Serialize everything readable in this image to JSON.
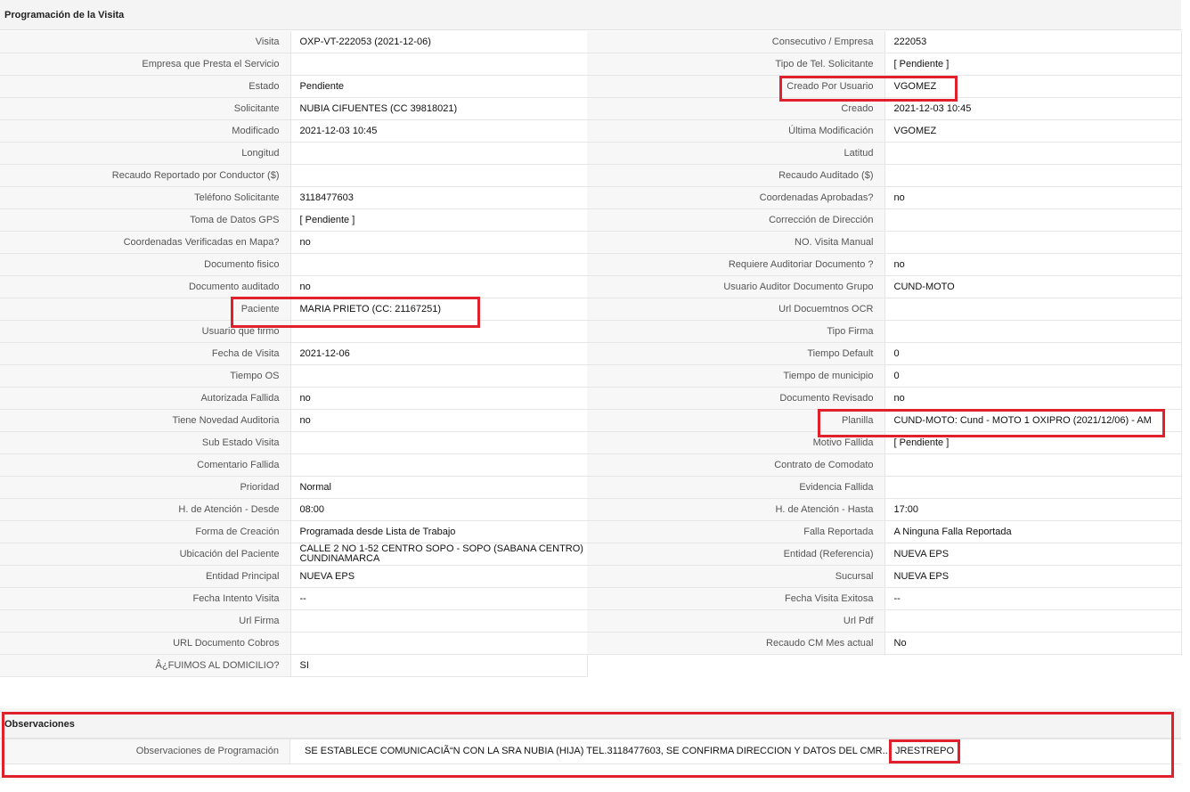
{
  "section1": {
    "title": "Programación de la Visita"
  },
  "left_rows": [
    {
      "label": "Visita",
      "value": "OXP-VT-222053 (2021-12-06)"
    },
    {
      "label": "Empresa que Presta el Servicio",
      "value": ""
    },
    {
      "label": "Estado",
      "value": "Pendiente"
    },
    {
      "label": "Solicitante",
      "value": "NUBIA CIFUENTES (CC 39818021)"
    },
    {
      "label": "Modificado",
      "value": "2021-12-03 10:45"
    },
    {
      "label": "Longitud",
      "value": ""
    },
    {
      "label": "Recaudo Reportado por Conductor ($)",
      "value": ""
    },
    {
      "label": "Teléfono Solicitante",
      "value": "3118477603"
    },
    {
      "label": "Toma de Datos GPS",
      "value": "[ Pendiente ]"
    },
    {
      "label": "Coordenadas Verificadas en Mapa?",
      "value": "no"
    },
    {
      "label": "Documento fisico",
      "value": ""
    },
    {
      "label": "Documento auditado",
      "value": "no"
    },
    {
      "label": "Paciente",
      "value": "MARIA PRIETO (CC: 21167251)"
    },
    {
      "label": "Usuario que firmo",
      "value": ""
    },
    {
      "label": "Fecha de Visita",
      "value": "2021-12-06"
    },
    {
      "label": "Tiempo OS",
      "value": ""
    },
    {
      "label": "Autorizada Fallida",
      "value": "no"
    },
    {
      "label": "Tiene Novedad Auditoria",
      "value": "no"
    },
    {
      "label": "Sub Estado Visita",
      "value": ""
    },
    {
      "label": "Comentario Fallida",
      "value": ""
    },
    {
      "label": "Prioridad",
      "value": "Normal"
    },
    {
      "label": "H. de Atención - Desde",
      "value": "08:00"
    },
    {
      "label": "Forma de Creación",
      "value": "Programada desde Lista de Trabajo"
    },
    {
      "label": "Ubicación del Paciente",
      "value": "CALLE 2 NO 1-52 CENTRO SOPO - SOPO (SABANA CENTRO) CUNDINAMARCA"
    },
    {
      "label": "Entidad Principal",
      "value": "NUEVA EPS"
    },
    {
      "label": "Fecha Intento Visita",
      "value": "--"
    },
    {
      "label": "Url Firma",
      "value": ""
    },
    {
      "label": "URL Documento Cobros",
      "value": ""
    },
    {
      "label": "Â¿FUIMOS AL DOMICILIO?",
      "value": "SI"
    }
  ],
  "right_rows": [
    {
      "label": "Consecutivo / Empresa",
      "value": "222053"
    },
    {
      "label": "Tipo de Tel. Solicitante",
      "value": "[ Pendiente ]"
    },
    {
      "label": "Creado Por Usuario",
      "value": "VGOMEZ"
    },
    {
      "label": "Creado",
      "value": "2021-12-03 10:45"
    },
    {
      "label": "Última Modificación",
      "value": "VGOMEZ"
    },
    {
      "label": "Latitud",
      "value": ""
    },
    {
      "label": "Recaudo Auditado ($)",
      "value": ""
    },
    {
      "label": "Coordenadas Aprobadas?",
      "value": "no"
    },
    {
      "label": "Corrección de Dirección",
      "value": ""
    },
    {
      "label": "NO. Visita Manual",
      "value": ""
    },
    {
      "label": "Requiere Auditoriar Documento ?",
      "value": "no"
    },
    {
      "label": "Usuario Auditor Documento Grupo",
      "value": "CUND-MOTO"
    },
    {
      "label": "Url Docuemtnos OCR",
      "value": ""
    },
    {
      "label": "Tipo Firma",
      "value": ""
    },
    {
      "label": "Tiempo Default",
      "value": "0"
    },
    {
      "label": "Tiempo de municipio",
      "value": "0"
    },
    {
      "label": "Documento Revisado",
      "value": "no"
    },
    {
      "label": "Planilla",
      "value": "CUND-MOTO: Cund - MOTO 1 OXIPRO (2021/12/06) - AM"
    },
    {
      "label": "Motivo Fallida",
      "value": "[ Pendiente ]"
    },
    {
      "label": "Contrato de Comodato",
      "value": ""
    },
    {
      "label": "Evidencia Fallida",
      "value": ""
    },
    {
      "label": "H. de Atención - Hasta",
      "value": "17:00"
    },
    {
      "label": "Falla Reportada",
      "value": "A Ninguna Falla Reportada"
    },
    {
      "label": "Entidad (Referencia)",
      "value": "NUEVA EPS"
    },
    {
      "label": "Sucursal",
      "value": "NUEVA EPS"
    },
    {
      "label": "Fecha Visita Exitosa",
      "value": "--"
    },
    {
      "label": "Url Pdf",
      "value": ""
    },
    {
      "label": "Recaudo CM Mes actual",
      "value": "No"
    }
  ],
  "section2": {
    "title": "Observaciones"
  },
  "observaciones": {
    "label": "Observaciones de Programación",
    "value": "SE ESTABLECE COMUNICACIÃ“N CON LA SRA NUBIA (HIJA) TEL.3118477603, SE CONFIRMA DIRECCION Y DATOS DEL CMR..",
    "user": "JRESTREPO"
  },
  "colors": {
    "highlight": "#e0202a",
    "label_bg": "#f7f7f7",
    "header_bg": "#f4f4f4"
  }
}
